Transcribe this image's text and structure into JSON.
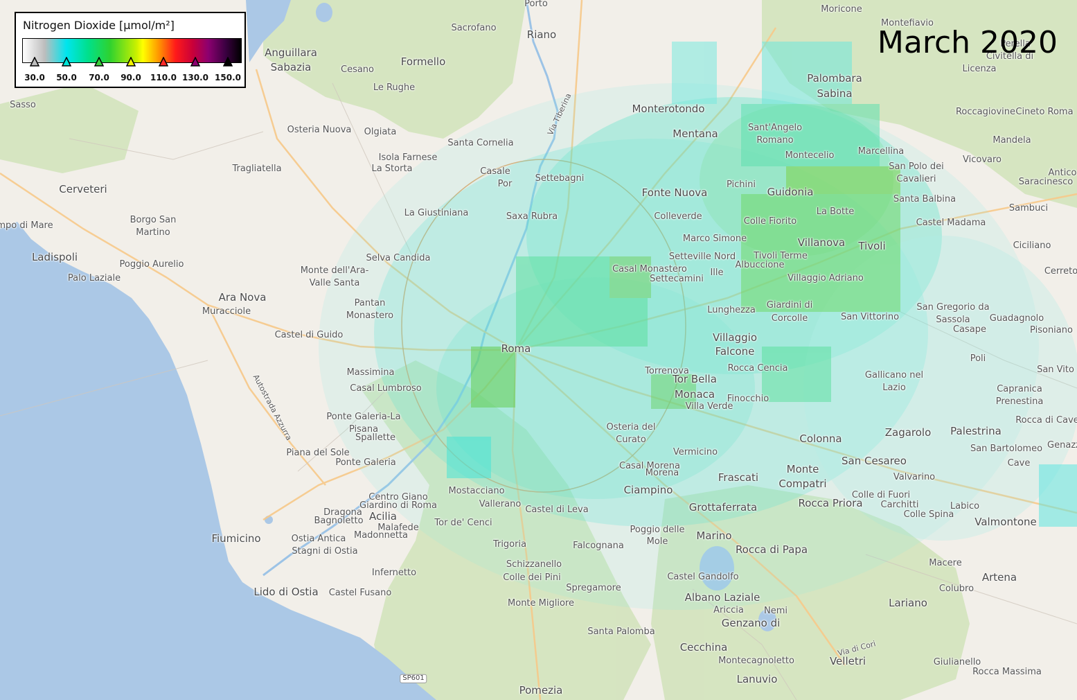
{
  "legend": {
    "title": "Nitrogen Dioxide [μmol/m²]",
    "ticks": [
      {
        "label": "30.0",
        "color": "#bdbdbd"
      },
      {
        "label": "50.0",
        "color": "#00e5d8"
      },
      {
        "label": "70.0",
        "color": "#3ccf3c"
      },
      {
        "label": "90.0",
        "color": "#f5f500"
      },
      {
        "label": "110.0",
        "color": "#ff2a2a"
      },
      {
        "label": "130.0",
        "color": "#8c0070"
      },
      {
        "label": "150.0",
        "color": "#000000"
      }
    ],
    "colors": [
      "#ffffff",
      "#bdbdbd",
      "#00e5ee",
      "#00e08a",
      "#2fd22f",
      "#ffff00",
      "#ff9a00",
      "#ff1a1a",
      "#8c0070",
      "#000000"
    ]
  },
  "date_label": "March 2020",
  "road_shield": "SP601",
  "places": [
    "Porto",
    "Moricone",
    "Montefiavio",
    "Sacrofano",
    "Riano",
    "Anguillara",
    "Sabazia",
    "Formello",
    "Perella",
    "Civitella di",
    "Licenza",
    "Cesano",
    "Le Rughe",
    "Palombara",
    "Sabina",
    "Sasso",
    "Monterotondo",
    "Roccagiovine",
    "Cineto Roma",
    "Osteria Nuova",
    "Olgiata",
    "Via Tiberina",
    "Sant'Angelo",
    "Romano",
    "Mentana",
    "Mandela",
    "Santa Cornelia",
    "Isola Farnese",
    "La Storta",
    "Montecelio",
    "Marcellina",
    "Vicovaro",
    "Tragliatella",
    "Casale",
    "Por",
    "Settebagni",
    "San Polo dei",
    "Cavalieri",
    "Cerveteri",
    "Pichini",
    "Fonte Nuova",
    "Guidonia",
    "Santa Balbina",
    "Saracinesco",
    "Antico",
    "Borgo San",
    "Martino",
    "La Giustiniana",
    "Saxa Rubra",
    "Colleverde",
    "La Botte",
    "Sambuci",
    "Castel Madama",
    "Marco Simone",
    "Colle Fiorito",
    "mpo di Mare",
    "Villanova",
    "Tivoli",
    "Ciciliano",
    "Ladispoli",
    "Poggio Aurelio",
    "Selva Candida",
    "Setteville Nord",
    "Tivoli Terme",
    "Casal Monastero",
    "Albuccione",
    "Palo Laziale",
    "Monte dell'Ara-",
    "Valle Santa",
    "Settecamini",
    "Ille",
    "Villaggio Adriano",
    "Cerreto",
    "Ara Nova",
    "Pantan",
    "Monastero",
    "Giardini di",
    "Corcolle",
    "Lunghezza",
    "San Gregorio da",
    "Sassola",
    "Muracciole",
    "Guadagnolo",
    "Casape",
    "San Vittorino",
    "Pisoniano",
    "Castel di Guido",
    "Villaggio",
    "Falcone",
    "Roma",
    "Massimina",
    "Poli",
    "Torrenova",
    "Rocca Cencia",
    "Gallicano nel",
    "Lazio",
    "San Vito",
    "Casal Lumbroso",
    "Tor Bella",
    "Monaca",
    "Capranica",
    "Prenestina",
    "Finocchio",
    "Villa Verde",
    "Ponte Galeria-La",
    "Pisana",
    "Spallette",
    "Osteria del",
    "Curato",
    "Rocca di Cave",
    "Zagarolo",
    "Palestrina",
    "Colonna",
    "Genazza",
    "San Bartolomeo",
    "Piana del Sole",
    "Vermicino",
    "Monte",
    "Compatri",
    "San Cesareo",
    "Cave",
    "Ponte Galeria",
    "Casal Morena",
    "Frascati",
    "Valvarino",
    "Morena",
    "Mostacciano",
    "Ciampino",
    "Colle di Fuori",
    "Centro Giano",
    "Giardino di Roma",
    "Labico",
    "Dragona",
    "Bagnoletto",
    "Acilia",
    "Vallerano",
    "Castel di Leva",
    "Grottaferrata",
    "Rocca Priora",
    "Carchitti",
    "Colle Spina",
    "Valmontone",
    "Malafede",
    "Madonnetta",
    "Tor de' Cenci",
    "Poggio delle",
    "Mole",
    "Marino",
    "Fiumicino",
    "Ostia Antica",
    "Stagni di Ostia",
    "Trigoria",
    "Falcognana",
    "Rocca di Papa",
    "Macere",
    "Infernetto",
    "Schizzanello",
    "Colle dei Pini",
    "Castel Gandolfo",
    "Artena",
    "Colubro",
    "Lido di Ostia",
    "Castel Fusano",
    "Spregamore",
    "Albano Laziale",
    "Lariano",
    "Ariccia",
    "Nemi",
    "Monte Migliore",
    "Genzano di",
    "Santa Palomba",
    "Cecchina",
    "Via di Cori",
    "Montecagnoletto",
    "Velletri",
    "Giulianello",
    "Rocca Massima",
    "Lanuvio",
    "Pomezia",
    "Autostrada Azzurra"
  ]
}
